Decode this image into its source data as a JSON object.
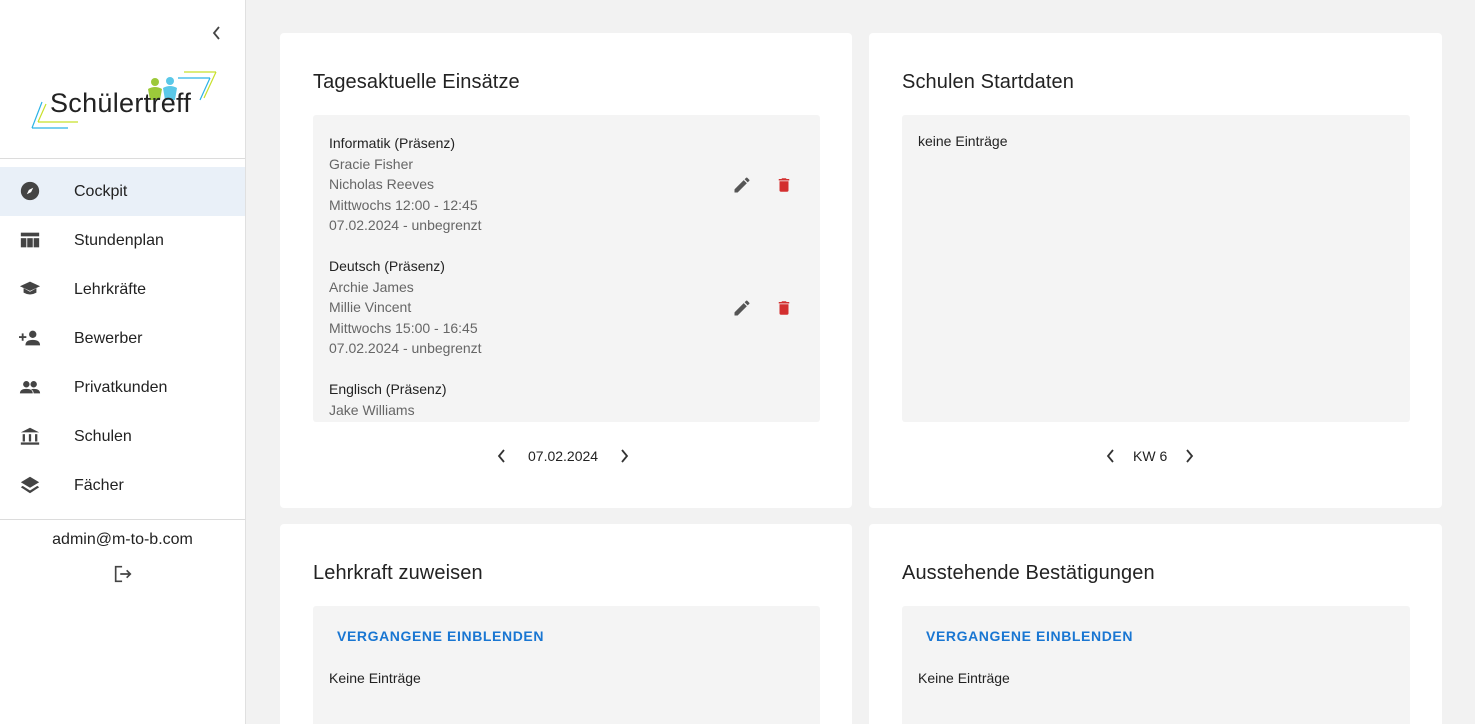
{
  "sidebar": {
    "logo_text": "Schülertreff",
    "items": [
      {
        "label": "Cockpit",
        "icon": "compass-icon",
        "active": true
      },
      {
        "label": "Stundenplan",
        "icon": "table-icon"
      },
      {
        "label": "Lehrkräfte",
        "icon": "graduation-cap-icon"
      },
      {
        "label": "Bewerber",
        "icon": "person-add-icon"
      },
      {
        "label": "Privatkunden",
        "icon": "people-icon"
      },
      {
        "label": "Schulen",
        "icon": "bank-icon"
      },
      {
        "label": "Fächer",
        "icon": "layers-icon"
      }
    ],
    "user_email": "admin@m-to-b.com"
  },
  "cards": {
    "daily": {
      "title": "Tagesaktuelle Einsätze",
      "entries": [
        {
          "subject": "Informatik (Präsenz)",
          "teacher": "Gracie Fisher",
          "student": "Nicholas Reeves",
          "time": "Mittwochs 12:00 - 12:45",
          "period": "07.02.2024 - unbegrenzt"
        },
        {
          "subject": "Deutsch (Präsenz)",
          "teacher": "Archie James",
          "student": "Millie Vincent",
          "time": "Mittwochs 15:00 - 16:45",
          "period": "07.02.2024 - unbegrenzt"
        },
        {
          "subject": "Englisch (Präsenz)",
          "teacher": "Jake Williams"
        }
      ],
      "date": "07.02.2024"
    },
    "schools": {
      "title": "Schulen Startdaten",
      "empty": "keine Einträge",
      "week": "KW 6"
    },
    "assign": {
      "title": "Lehrkraft zuweisen",
      "show_past": "VERGANGENE EINBLENDEN",
      "empty": "Keine Einträge"
    },
    "pending": {
      "title": "Ausstehende Bestätigungen",
      "show_past": "VERGANGENE EINBLENDEN",
      "empty": "Keine Einträge"
    }
  },
  "colors": {
    "accent": "#1976d2",
    "delete": "#d32f2f",
    "active_bg": "#e9f0f8"
  }
}
